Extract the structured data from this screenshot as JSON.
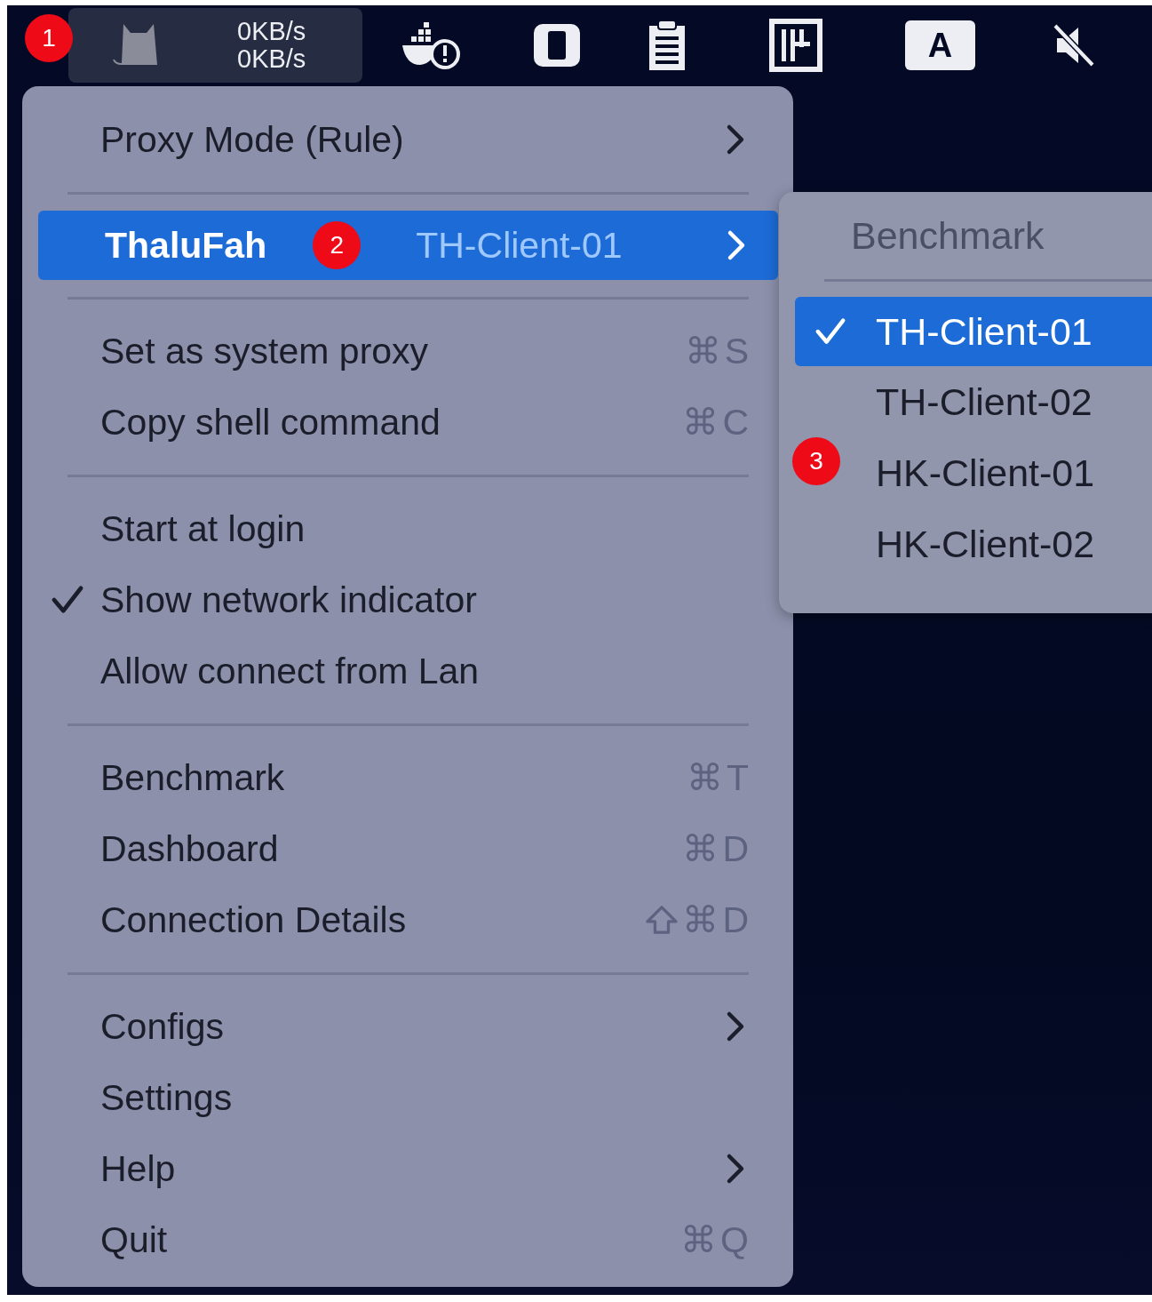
{
  "menu_bar": {
    "badge": "1",
    "network": {
      "upload": "0KB/s",
      "download": "0KB/s"
    },
    "input_source": "A"
  },
  "menu": {
    "items": [
      {
        "kind": "item",
        "label": "Proxy Mode (Rule)",
        "submenu": true,
        "checked": false,
        "selected": false
      },
      {
        "kind": "separator"
      },
      {
        "kind": "item",
        "label": "ThaluFah",
        "badge": "2",
        "value": "TH-Client-01",
        "submenu": true,
        "checked": false,
        "selected": true
      },
      {
        "kind": "separator"
      },
      {
        "kind": "item",
        "label": "Set as system proxy",
        "shortcut": "⌘S",
        "checked": false,
        "selected": false
      },
      {
        "kind": "item",
        "label": "Copy shell command",
        "shortcut": "⌘C",
        "checked": false,
        "selected": false
      },
      {
        "kind": "separator"
      },
      {
        "kind": "item",
        "label": "Start at login",
        "checked": false,
        "selected": false
      },
      {
        "kind": "item",
        "label": "Show network indicator",
        "checked": true,
        "selected": false
      },
      {
        "kind": "item",
        "label": "Allow connect from Lan",
        "checked": false,
        "selected": false
      },
      {
        "kind": "separator"
      },
      {
        "kind": "item",
        "label": "Benchmark",
        "shortcut": "⌘T",
        "checked": false,
        "selected": false
      },
      {
        "kind": "item",
        "label": "Dashboard",
        "shortcut": "⌘D",
        "checked": false,
        "selected": false
      },
      {
        "kind": "item",
        "label": "Connection Details",
        "shortcut": "⌘D",
        "shift": true,
        "checked": false,
        "selected": false
      },
      {
        "kind": "separator"
      },
      {
        "kind": "item",
        "label": "Configs",
        "submenu": true,
        "checked": false,
        "selected": false
      },
      {
        "kind": "item",
        "label": "Settings",
        "checked": false,
        "selected": false
      },
      {
        "kind": "item",
        "label": "Help",
        "submenu": true,
        "checked": false,
        "selected": false
      },
      {
        "kind": "item",
        "label": "Quit",
        "shortcut": "⌘Q",
        "checked": false,
        "selected": false
      }
    ]
  },
  "submenu": {
    "header": "Benchmark",
    "items": [
      {
        "label": "TH-Client-01",
        "checked": true,
        "selected": true
      },
      {
        "label": "TH-Client-02",
        "checked": false,
        "selected": false
      },
      {
        "label": "HK-Client-01",
        "checked": false,
        "selected": false,
        "badge": "3"
      },
      {
        "label": "HK-Client-02",
        "checked": false,
        "selected": false
      }
    ]
  }
}
